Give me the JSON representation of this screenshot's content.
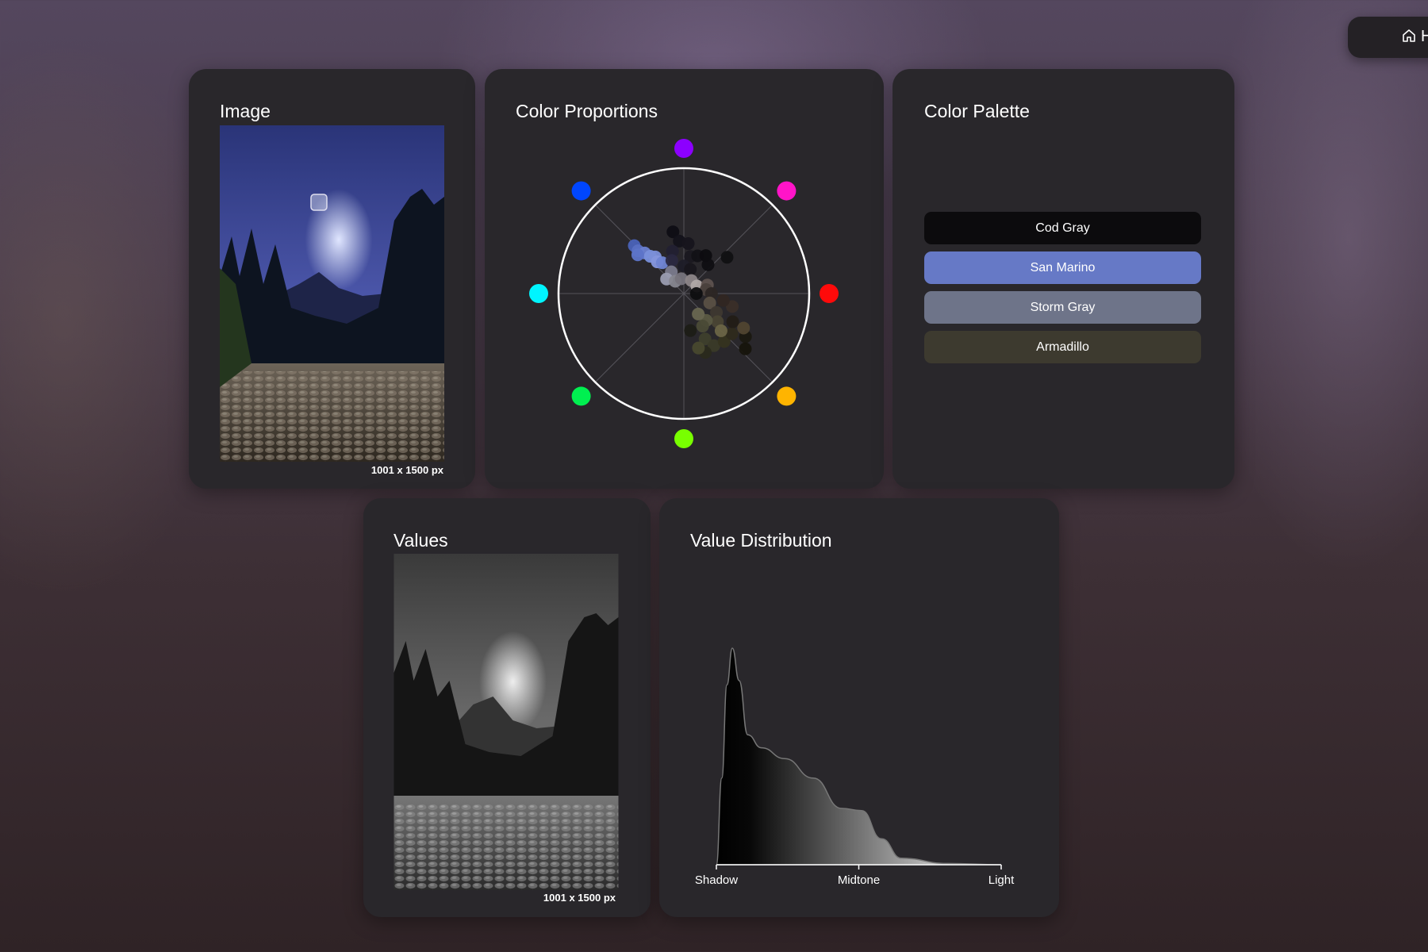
{
  "nav": {
    "home_label": "H",
    "home_icon": "home-icon"
  },
  "image_card": {
    "title": "Image",
    "caption": "1001 x 1500 px"
  },
  "proportions_card": {
    "title": "Color Proportions"
  },
  "palette_card": {
    "title": "Color Palette",
    "swatches": [
      {
        "name": "Cod Gray",
        "color": "#0c0b0d"
      },
      {
        "name": "San Marino",
        "color": "#6679c6"
      },
      {
        "name": "Storm Gray",
        "color": "#6e7489"
      },
      {
        "name": "Armadillo",
        "color": "#3d3a2f"
      }
    ]
  },
  "values_card": {
    "title": "Values",
    "caption": "1001 x 1500 px"
  },
  "distribution_card": {
    "title": "Value Distribution"
  },
  "chart_data": [
    {
      "type": "scatter",
      "title": "Color Proportions",
      "hue_markers": [
        {
          "hue": 0,
          "color": "#ff0a0a"
        },
        {
          "hue": 45,
          "color": "#ff14c8"
        },
        {
          "hue": 90,
          "color": "#8c00ff"
        },
        {
          "hue": 135,
          "color": "#0046ff"
        },
        {
          "hue": 180,
          "color": "#00f5ff"
        },
        {
          "hue": 225,
          "color": "#00f050"
        },
        {
          "hue": 270,
          "color": "#78ff00"
        },
        {
          "hue": 315,
          "color": "#ffb400"
        }
      ],
      "points": [
        {
          "angle": 136,
          "sat": 0.55,
          "color": "#4a62b8"
        },
        {
          "angle": 137,
          "sat": 0.5,
          "color": "#5a70c4"
        },
        {
          "angle": 134,
          "sat": 0.45,
          "color": "#6a80d0"
        },
        {
          "angle": 132,
          "sat": 0.4,
          "color": "#7990dc"
        },
        {
          "angle": 128,
          "sat": 0.37,
          "color": "#7b8fd8"
        },
        {
          "angle": 140,
          "sat": 0.48,
          "color": "#5d74c8"
        },
        {
          "angle": 130,
          "sat": 0.33,
          "color": "#8596dc"
        },
        {
          "angle": 125,
          "sat": 0.3,
          "color": "#6f84d2"
        },
        {
          "angle": 100,
          "sat": 0.5,
          "color": "#0e0d14"
        },
        {
          "angle": 95,
          "sat": 0.42,
          "color": "#13121a"
        },
        {
          "angle": 85,
          "sat": 0.4,
          "color": "#16141c"
        },
        {
          "angle": 80,
          "sat": 0.3,
          "color": "#1a1820"
        },
        {
          "angle": 70,
          "sat": 0.32,
          "color": "#121116"
        },
        {
          "angle": 60,
          "sat": 0.35,
          "color": "#0d0c10"
        },
        {
          "angle": 105,
          "sat": 0.35,
          "color": "#222032"
        },
        {
          "angle": 110,
          "sat": 0.28,
          "color": "#2a2840"
        },
        {
          "angle": 90,
          "sat": 0.22,
          "color": "#1e1c28"
        },
        {
          "angle": 75,
          "sat": 0.2,
          "color": "#18161c"
        },
        {
          "angle": 50,
          "sat": 0.3,
          "color": "#0f0e12"
        },
        {
          "angle": 40,
          "sat": 0.45,
          "color": "#101012"
        },
        {
          "angle": 120,
          "sat": 0.2,
          "color": "#7a7a8c"
        },
        {
          "angle": 140,
          "sat": 0.18,
          "color": "#9a9cb0"
        },
        {
          "angle": 125,
          "sat": 0.12,
          "color": "#86868f"
        },
        {
          "angle": 100,
          "sat": 0.12,
          "color": "#76737c"
        },
        {
          "angle": 60,
          "sat": 0.12,
          "color": "#8c8588"
        },
        {
          "angle": 30,
          "sat": 0.12,
          "color": "#b0a8a6"
        },
        {
          "angle": 20,
          "sat": 0.2,
          "color": "#5e524f"
        },
        {
          "angle": 10,
          "sat": 0.18,
          "color": "#4a403c"
        },
        {
          "angle": 0,
          "sat": 0.22,
          "color": "#2c2624"
        },
        {
          "angle": 340,
          "sat": 0.22,
          "color": "#5a5044"
        },
        {
          "angle": 330,
          "sat": 0.3,
          "color": "#3e3830"
        },
        {
          "angle": 320,
          "sat": 0.35,
          "color": "#4a4434"
        },
        {
          "angle": 310,
          "sat": 0.28,
          "color": "#5a5842"
        },
        {
          "angle": 300,
          "sat": 0.3,
          "color": "#4a4a36"
        },
        {
          "angle": 295,
          "sat": 0.4,
          "color": "#3e3f2c"
        },
        {
          "angle": 300,
          "sat": 0.48,
          "color": "#3a3a28"
        },
        {
          "angle": 290,
          "sat": 0.5,
          "color": "#2a2a1c"
        },
        {
          "angle": 310,
          "sat": 0.5,
          "color": "#35331f"
        },
        {
          "angle": 320,
          "sat": 0.5,
          "color": "#2e2a1c"
        },
        {
          "angle": 325,
          "sat": 0.6,
          "color": "#1a1810"
        },
        {
          "angle": 318,
          "sat": 0.66,
          "color": "#16140c"
        },
        {
          "angle": 330,
          "sat": 0.55,
          "color": "#504430"
        },
        {
          "angle": 345,
          "sat": 0.4,
          "color": "#3a2e28"
        },
        {
          "angle": 350,
          "sat": 0.32,
          "color": "#302622"
        },
        {
          "angle": 315,
          "sat": 0.42,
          "color": "#6a6446"
        },
        {
          "angle": 305,
          "sat": 0.2,
          "color": "#686650"
        },
        {
          "angle": 280,
          "sat": 0.3,
          "color": "#1c1c16"
        },
        {
          "angle": 285,
          "sat": 0.45,
          "color": "#48482e"
        },
        {
          "angle": 330,
          "sat": 0.45,
          "color": "#221c16"
        },
        {
          "angle": 0,
          "sat": 0.1,
          "color": "#0e0e10"
        }
      ]
    },
    {
      "type": "area",
      "title": "Value Distribution",
      "x_tick_labels": [
        "Shadow",
        "Midtone",
        "Light"
      ],
      "xlim": [
        0,
        100
      ],
      "x": [
        0,
        1.9,
        3.7,
        5.6,
        8,
        11,
        15.8,
        24,
        34,
        44,
        51,
        58,
        65,
        81,
        100
      ],
      "y": [
        0,
        0.4,
        0.83,
        1.0,
        0.85,
        0.6,
        0.54,
        0.49,
        0.4,
        0.26,
        0.25,
        0.12,
        0.03,
        0.006,
        0
      ]
    }
  ]
}
